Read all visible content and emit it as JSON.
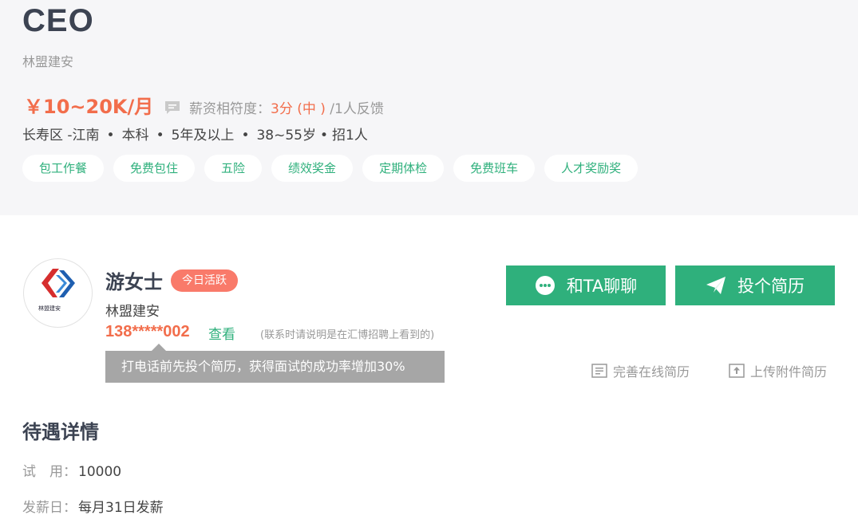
{
  "job": {
    "title": "CEO",
    "company": "林盟建安",
    "salary": "￥10~20K/月",
    "match_label": "薪资相符度：",
    "match_score": "3分 (中 )",
    "match_feedback": "/1人反馈",
    "requirements": [
      "长寿区 -江南",
      "本科",
      "5年及以上",
      "38~55岁",
      "招1人"
    ],
    "tags": [
      "包工作餐",
      "免费包住",
      "五险",
      "绩效奖金",
      "定期体检",
      "免费班车",
      "人才奖励奖"
    ]
  },
  "recruiter": {
    "name": "游女士",
    "badge": "今日活跃",
    "company": "林盟建安",
    "logo_text": "林盟建安",
    "phone": "138*****002",
    "view_label": "查看",
    "note": "(联系时请说明是在汇博招聘上看到的)",
    "tooltip": "打电话前先投个简历，获得面试的成功率增加30%"
  },
  "actions": {
    "chat": "和TA聊聊",
    "apply": "投个简历",
    "online_resume": "完善在线简历",
    "upload_resume": "上传附件简历"
  },
  "benefits": {
    "title": "待遇详情",
    "rows": [
      {
        "key": "试　用：",
        "value": "10000"
      },
      {
        "key": "发薪日：",
        "value": "每月31日发薪"
      }
    ]
  },
  "colors": {
    "accent_green": "#2fb07c",
    "salary_orange": "#f26d4b",
    "badge_red": "#f97a6a"
  }
}
